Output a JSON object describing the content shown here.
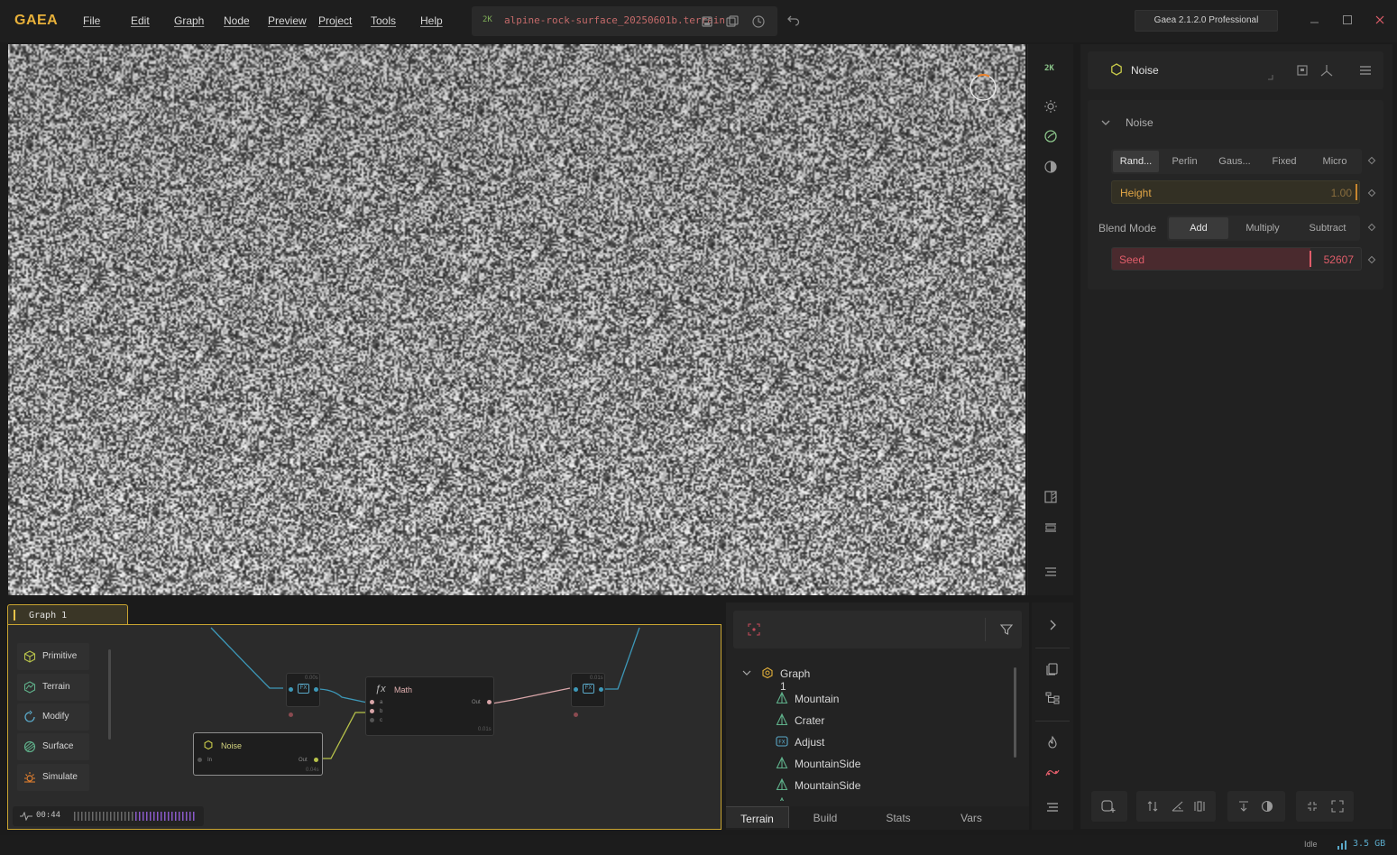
{
  "app": {
    "logo": "GAEA",
    "menus": [
      "File",
      "Edit",
      "Graph",
      "Node",
      "Preview",
      "Project",
      "Tools",
      "Help"
    ],
    "file_resolution": "2K",
    "file_name": "alpine-rock-surface_20250601b.terrain",
    "version": "Gaea 2.1.2.0 Professional"
  },
  "viewport": {
    "resolution_badge": "2K"
  },
  "properties": {
    "node_title": "Noise",
    "section_title": "Noise",
    "noise_types": [
      "Rand...",
      "Perlin",
      "Gaus...",
      "Fixed",
      "Micro"
    ],
    "noise_type_selected": 0,
    "height_label": "Height",
    "height_value": "1.00",
    "blend_mode_label": "Blend Mode",
    "blend_modes": [
      "Add",
      "Multiply",
      "Subtract"
    ],
    "blend_mode_selected": 0,
    "seed_label": "Seed",
    "seed_value": "52607"
  },
  "graph": {
    "tab_label": "Graph 1",
    "palette": [
      "Primitive",
      "Terrain",
      "Modify",
      "Surface",
      "Simulate"
    ],
    "timeline_time": "00:44",
    "nodes": {
      "noise": {
        "label": "Noise",
        "in": "In",
        "out": "Out",
        "time": "0.04s"
      },
      "math": {
        "label": "Math",
        "ports": [
          "a",
          "b",
          "c"
        ],
        "out": "Out",
        "time": "0.01s"
      },
      "fx1": {
        "label": "FX",
        "time": "0.00s"
      },
      "fx2": {
        "label": "FX",
        "time": "0.01s"
      }
    }
  },
  "explorer": {
    "search_placeholder": "",
    "root": "Graph 1",
    "items": [
      {
        "label": "Mountain",
        "icon": "mountain-icon"
      },
      {
        "label": "Crater",
        "icon": "mountain-icon"
      },
      {
        "label": "Adjust",
        "icon": "fx-icon"
      },
      {
        "label": "MountainSide",
        "icon": "mountain-icon"
      },
      {
        "label": "MountainSide",
        "icon": "mountain-icon"
      }
    ],
    "tabs": [
      "Terrain",
      "Build",
      "Stats",
      "Vars"
    ],
    "active_tab": 0
  },
  "status": {
    "state": "Idle",
    "memory": "3.5 GB"
  },
  "colors": {
    "accent": "#e8b13a",
    "seed": "#e05d6a",
    "height": "#e2a646",
    "mountain_icon": "#5fb08a",
    "fx_icon": "#5aa9c9"
  }
}
